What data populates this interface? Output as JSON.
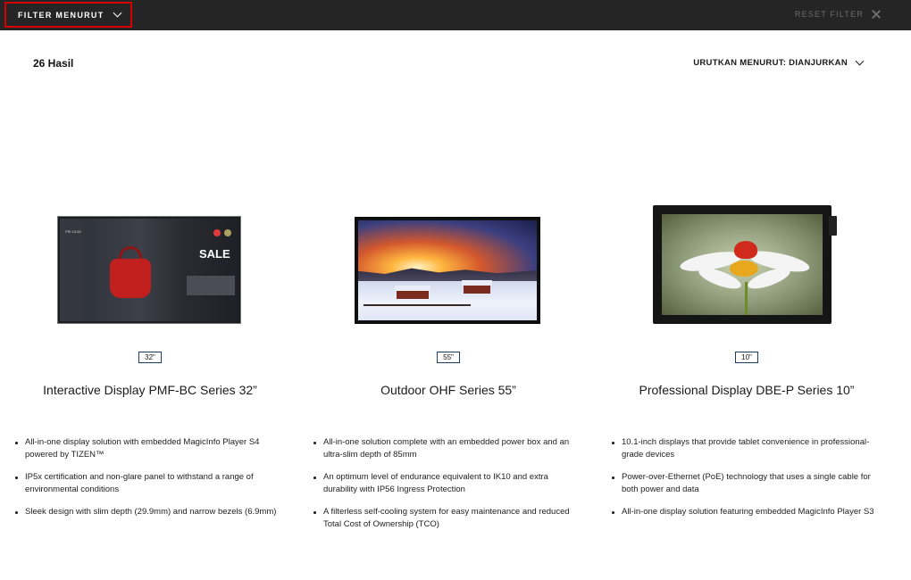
{
  "toolbar": {
    "filter_label": "FILTER MENURUT",
    "reset_label": "RESET FILTER"
  },
  "summary": {
    "results": "26 Hasil",
    "sort_label": "URUTKAN MENURUT: DIANJURKAN"
  },
  "products": [
    {
      "size": "32\"",
      "name": "Interactive Display PMF-BC Series 32”",
      "features": [
        "All-in-one display solution with embedded MagicInfo Player S4 powered by TIZEN™",
        "IP5x certification and non-glare panel to withstand a range of environmental conditions",
        "Sleek design with slim depth (29.9mm) and narrow bezels (6.9mm)"
      ],
      "screen_text": {
        "sale": "SALE",
        "time": "FRI 15:25"
      }
    },
    {
      "size": "55\"",
      "name": "Outdoor OHF Series 55”",
      "features": [
        "All-in-one solution complete with an embedded power box and an ultra-slim depth of 85mm",
        "An optimum level of endurance equivalent to IK10 and extra durability with IP56 Ingress Protection",
        "A filterless self-cooling system for easy maintenance and reduced Total Cost of Ownership (TCO)"
      ]
    },
    {
      "size": "10\"",
      "name": "Professional Display DBE-P Series 10”",
      "features": [
        "10.1-inch displays that provide tablet convenience in professional-grade devices",
        "Power-over-Ethernet (PoE) technology that uses a single cable for both power and data",
        "All-in-one display solution featuring embedded MagicInfo Player S3"
      ]
    }
  ],
  "colors": {
    "topbar": "#252525",
    "highlight_border": "#d60000",
    "badge_border": "#1a3a6a"
  }
}
